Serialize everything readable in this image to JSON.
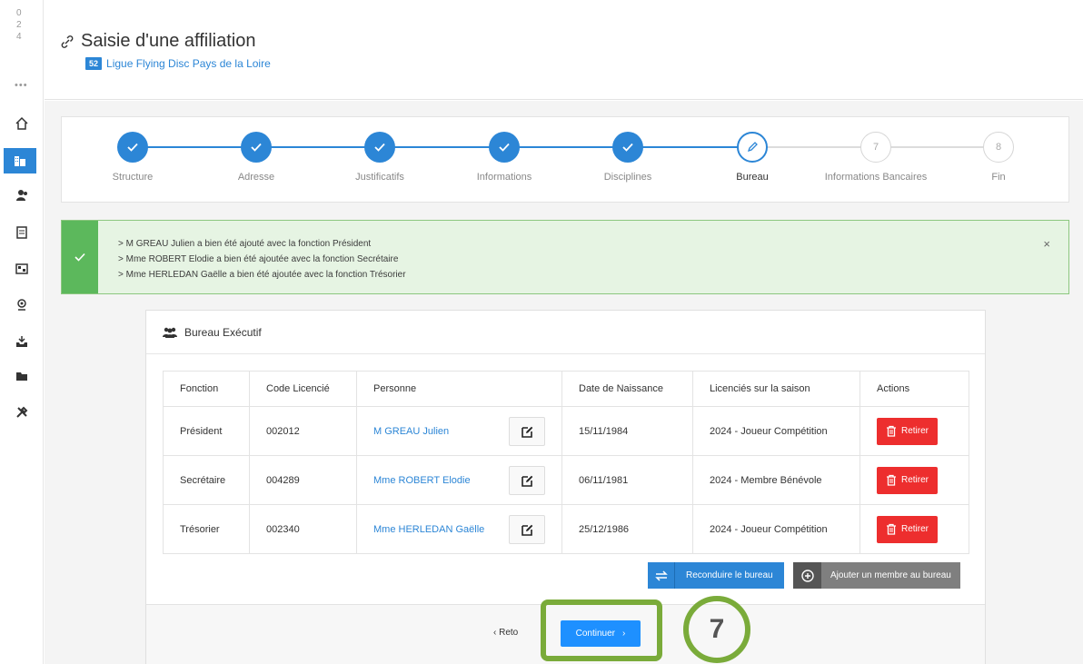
{
  "sidebar": {
    "numbers": [
      "0",
      "2",
      "4"
    ],
    "dots": "•••",
    "items": [
      {
        "icon": "home-icon",
        "name": "home"
      },
      {
        "icon": "building-icon",
        "name": "structure",
        "active": true
      },
      {
        "icon": "users-icon",
        "name": "users"
      },
      {
        "icon": "id-card-icon",
        "name": "licences"
      },
      {
        "icon": "flag-icon",
        "name": "competitions"
      },
      {
        "icon": "map-pin-icon",
        "name": "locations"
      },
      {
        "icon": "inbox-icon",
        "name": "inbox"
      },
      {
        "icon": "folder-icon",
        "name": "documents"
      },
      {
        "icon": "tools-icon",
        "name": "tools"
      }
    ]
  },
  "header": {
    "title": "Saisie d'une affiliation",
    "org_badge": "52",
    "org_name": "Ligue Flying Disc Pays de la Loire"
  },
  "stepper": {
    "steps": [
      {
        "label": "Structure",
        "state": "done",
        "number": ""
      },
      {
        "label": "Adresse",
        "state": "done",
        "number": ""
      },
      {
        "label": "Justificatifs",
        "state": "done",
        "number": ""
      },
      {
        "label": "Informations",
        "state": "done",
        "number": ""
      },
      {
        "label": "Disciplines",
        "state": "done",
        "number": ""
      },
      {
        "label": "Bureau",
        "state": "current",
        "number": ""
      },
      {
        "label": "Informations Bancaires",
        "state": "todo",
        "number": "7"
      },
      {
        "label": "Fin",
        "state": "todo",
        "number": "8"
      }
    ]
  },
  "alert": {
    "lines": [
      "> M GREAU Julien a bien été ajouté avec la fonction Président",
      "> Mme ROBERT Elodie a bien été ajoutée avec la fonction Secrétaire",
      "> Mme HERLEDAN Gaëlle a bien été ajoutée avec la fonction Trésorier"
    ],
    "close": "×"
  },
  "panel": {
    "title": "Bureau Exécutif",
    "columns": [
      "Fonction",
      "Code Licencié",
      "Personne",
      "Date de Naissance",
      "Licenciés sur la saison",
      "Actions"
    ],
    "rows": [
      {
        "fonction": "Président",
        "code": "002012",
        "personne": "M GREAU Julien",
        "naissance": "15/11/1984",
        "saison": "2024 - Joueur Compétition",
        "action": "Retirer"
      },
      {
        "fonction": "Secrétaire",
        "code": "004289",
        "personne": "Mme ROBERT Elodie",
        "naissance": "06/11/1981",
        "saison": "2024 - Membre Bénévole",
        "action": "Retirer"
      },
      {
        "fonction": "Trésorier",
        "code": "002340",
        "personne": "Mme HERLEDAN Gaëlle",
        "naissance": "25/12/1986",
        "saison": "2024 - Joueur Compétition",
        "action": "Retirer"
      }
    ],
    "renew_label": "Reconduire le bureau",
    "add_label": "Ajouter un membre au bureau",
    "back_label": "Reto",
    "continue_label": "Continuer"
  },
  "annotation": {
    "step_number": "7"
  },
  "colors": {
    "primary": "#2c86d6",
    "success": "#5cb85c",
    "danger": "#ed2e2e",
    "highlight": "#7aab3a"
  }
}
